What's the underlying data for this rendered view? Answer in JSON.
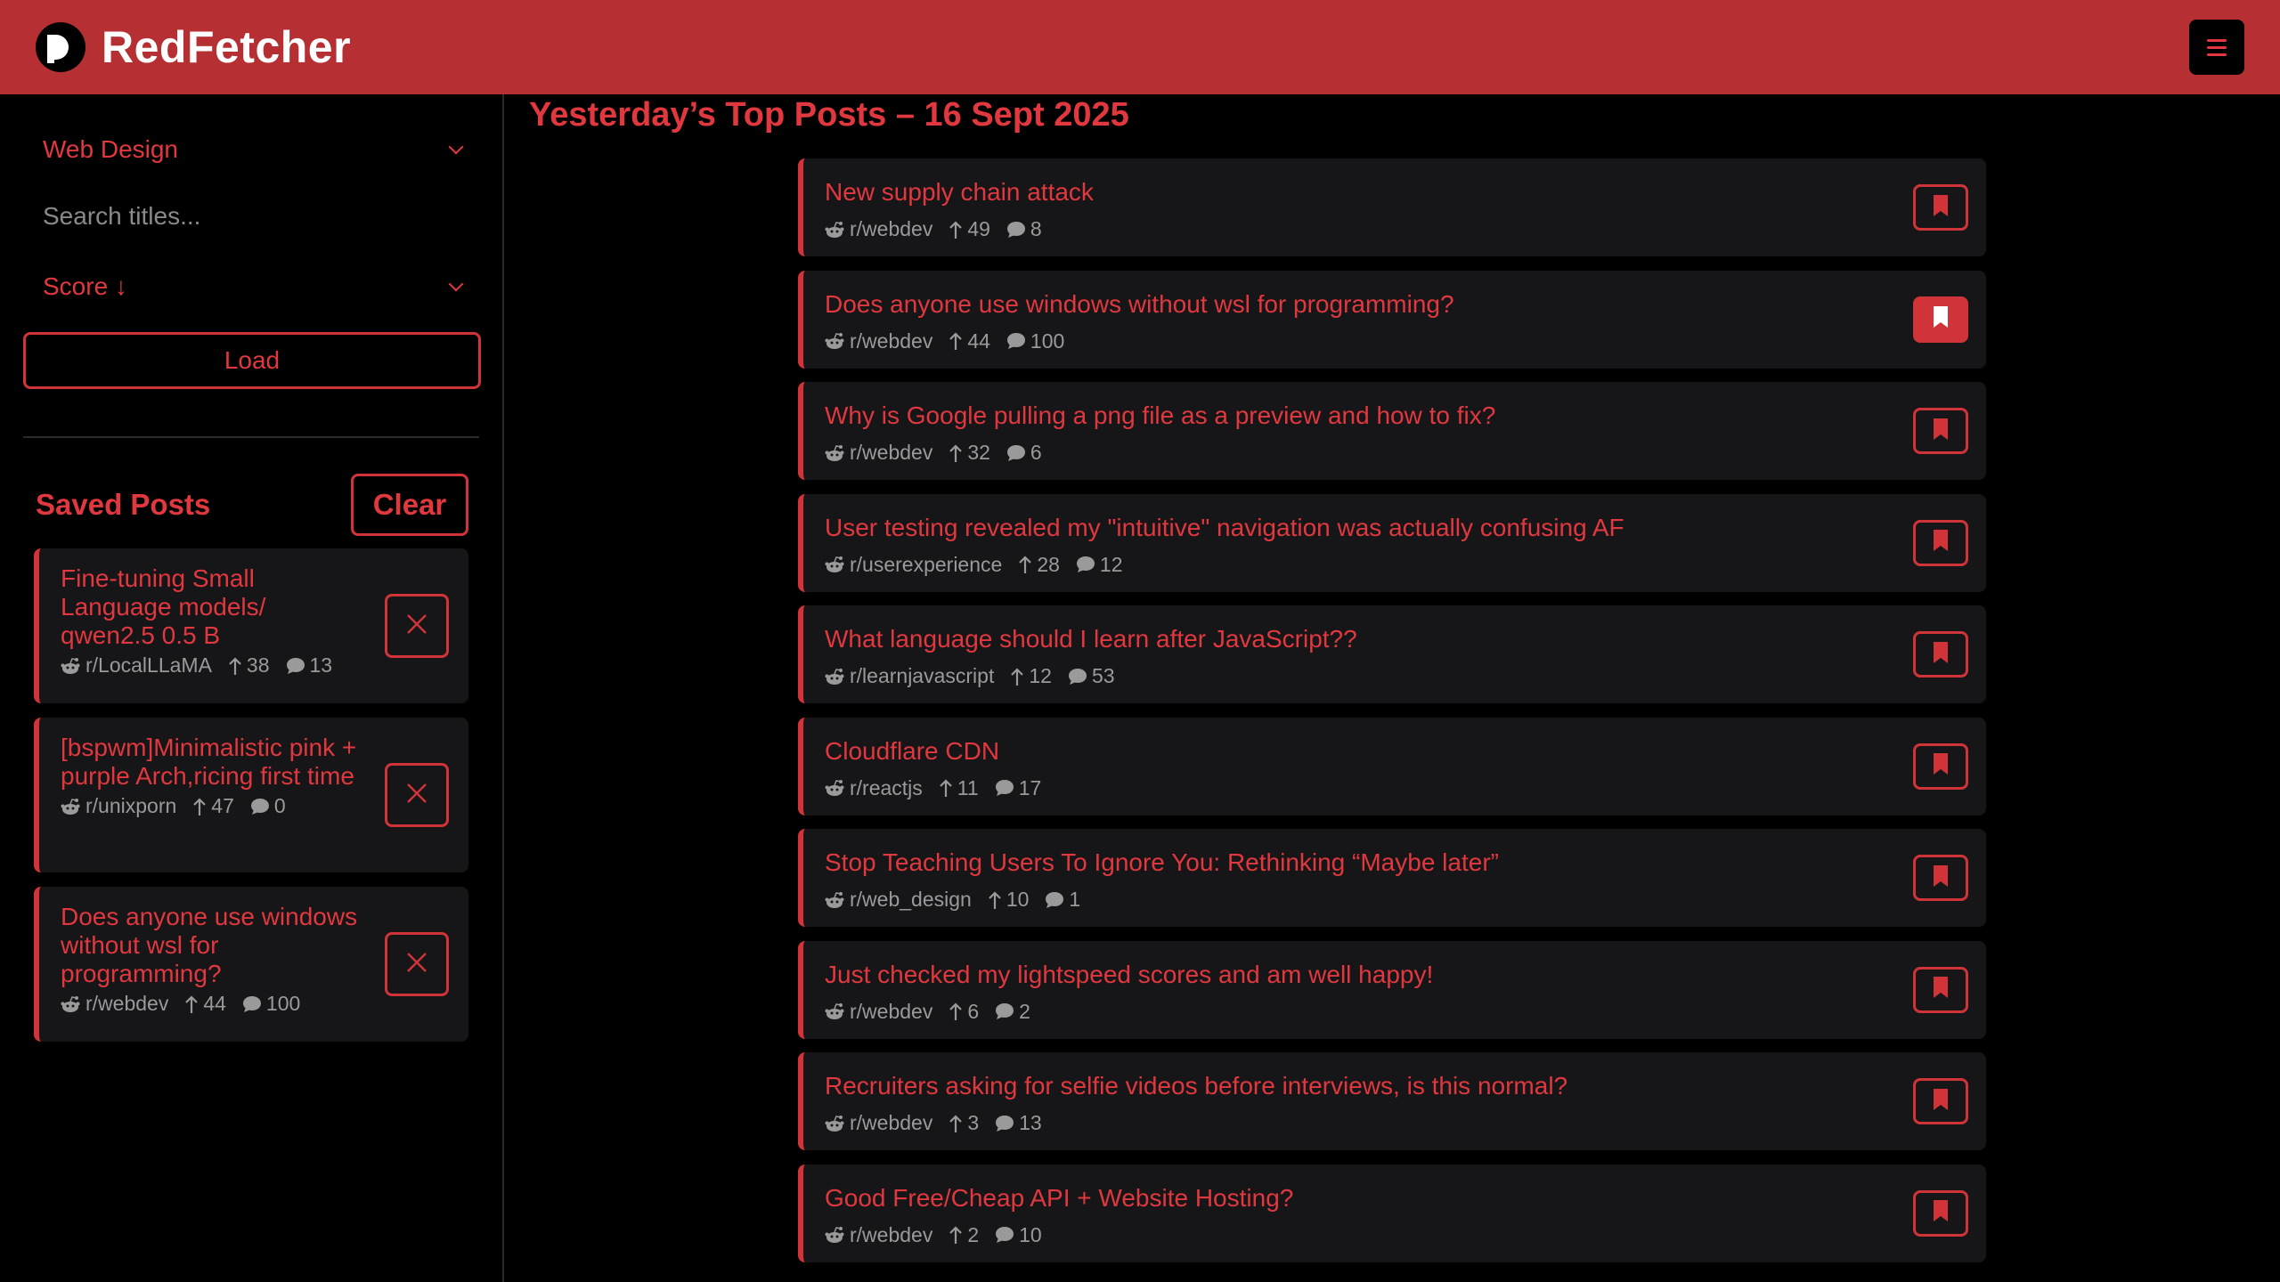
{
  "app": {
    "name": "RedFetcher"
  },
  "header": {
    "menu_icon": "hamburger-icon"
  },
  "sidebar": {
    "topic_select": "Web Design",
    "search_placeholder": "Search titles...",
    "sort_select": "Score ↓",
    "load_label": "Load",
    "saved_title": "Saved Posts",
    "clear_label": "Clear",
    "saved": [
      {
        "title": "Fine-tuning Small Language models/ qwen2.5 0.5 B",
        "subreddit": "r/LocalLLaMA",
        "score": "38",
        "comments": "13"
      },
      {
        "title": "[bspwm]Minimalistic pink + purple Arch,ricing first time",
        "subreddit": "r/unixporn",
        "score": "47",
        "comments": "0"
      },
      {
        "title": "Does anyone use windows without wsl for programming?",
        "subreddit": "r/webdev",
        "score": "44",
        "comments": "100"
      }
    ]
  },
  "main": {
    "title": "Yesterday’s Top Posts – 16 Sept 2025",
    "posts": [
      {
        "title": "New supply chain attack",
        "subreddit": "r/webdev",
        "score": "49",
        "comments": "8",
        "saved": false
      },
      {
        "title": "Does anyone use windows without wsl for programming?",
        "subreddit": "r/webdev",
        "score": "44",
        "comments": "100",
        "saved": true
      },
      {
        "title": "Why is Google pulling a png file as a preview and how to fix?",
        "subreddit": "r/webdev",
        "score": "32",
        "comments": "6",
        "saved": false
      },
      {
        "title": "User testing revealed my \"intuitive\" navigation was actually confusing AF",
        "subreddit": "r/userexperience",
        "score": "28",
        "comments": "12",
        "saved": false
      },
      {
        "title": "What language should I learn after JavaScript??",
        "subreddit": "r/learnjavascript",
        "score": "12",
        "comments": "53",
        "saved": false
      },
      {
        "title": "Cloudflare CDN",
        "subreddit": "r/reactjs",
        "score": "11",
        "comments": "17",
        "saved": false
      },
      {
        "title": "Stop Teaching Users To Ignore You: Rethinking “Maybe later”",
        "subreddit": "r/web_design",
        "score": "10",
        "comments": "1",
        "saved": false
      },
      {
        "title": "Just checked my lightspeed scores and am well happy!",
        "subreddit": "r/webdev",
        "score": "6",
        "comments": "2",
        "saved": false
      },
      {
        "title": "Recruiters asking for selfie videos before interviews, is this normal?",
        "subreddit": "r/webdev",
        "score": "3",
        "comments": "13",
        "saved": false
      },
      {
        "title": "Good Free/Cheap API + Website Hosting?",
        "subreddit": "r/webdev",
        "score": "2",
        "comments": "10",
        "saved": false
      }
    ]
  },
  "colors": {
    "accent": "#d13438",
    "header": "#b52f33",
    "card": "#161618"
  }
}
